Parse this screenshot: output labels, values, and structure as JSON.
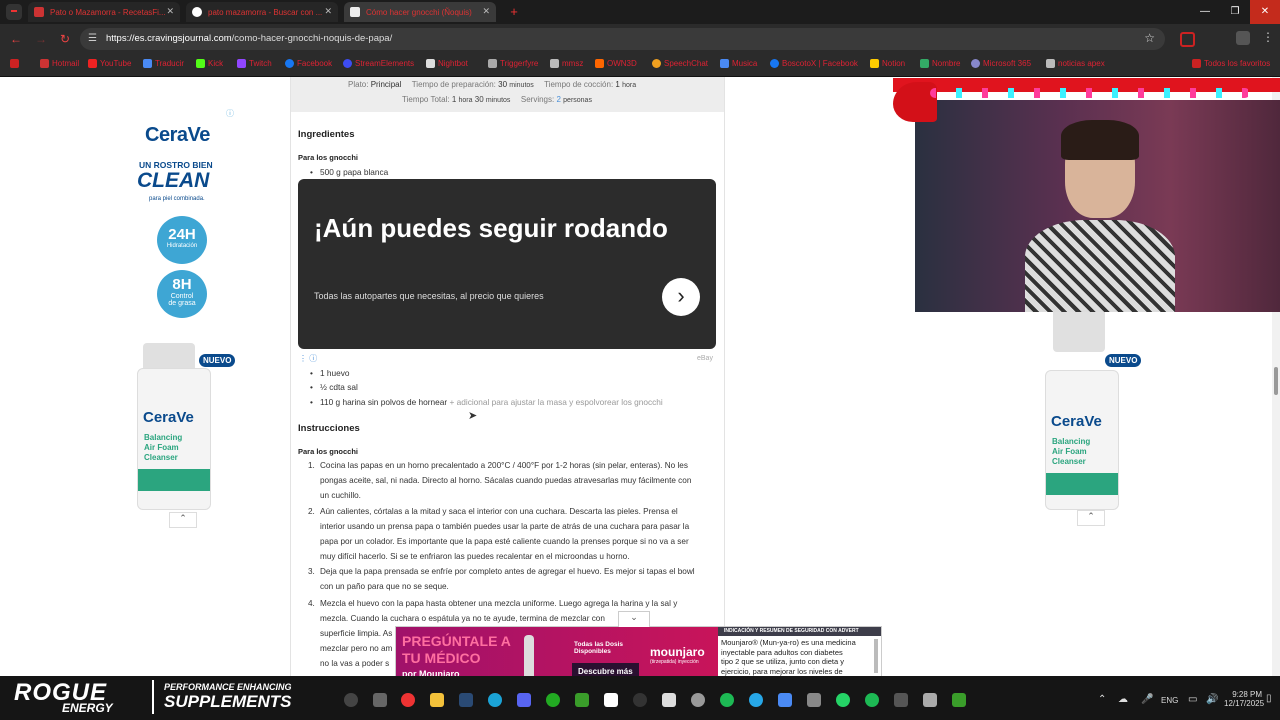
{
  "browser": {
    "tabs": [
      {
        "label": "Pato o Mazamorra - RecetasFi...",
        "active": false
      },
      {
        "label": "pato mazamorra - Buscar con ...",
        "active": false
      },
      {
        "label": "Cómo hacer gnocchi (Ñoquis)",
        "active": true
      }
    ],
    "url_domain": "https://es.cravingsjournal.com",
    "url_path": "/como-hacer-gnocchi-noquis-de-papa/",
    "bookmarks": [
      "Hotmail",
      "YouTube",
      "Traducir",
      "Kick",
      "Twitch",
      "Facebook",
      "StreamElements",
      "Nightbot",
      "Triggerfyre",
      "mmsz",
      "OWN3D",
      "SpeechChat",
      "Musica",
      "BoscotoX | Facebook",
      "Notion",
      "Nombre",
      "Microsoft 365",
      "noticias apex"
    ],
    "all_bookmarks": "Todos los favoritos"
  },
  "recipe": {
    "meta": {
      "plato_label": "Plato:",
      "plato_value": "Principal",
      "prep_label": "Tiempo de preparación:",
      "prep_value": "30",
      "prep_unit": "minutos",
      "cook_label": "Tiempo de cocción:",
      "cook_value": "1",
      "cook_unit": "hora",
      "total_label": "Tiempo Total:",
      "total_h": "1",
      "total_h_unit": "hora",
      "total_m": "30",
      "total_m_unit": "minutos",
      "servings_label": "Servings:",
      "servings_value": "2",
      "servings_unit": "personas"
    },
    "ingredients_title": "Ingredientes",
    "ingredients_group": "Para los gnocchi",
    "ingredients_top": [
      "500 g papa blanca"
    ],
    "ingredients": [
      "1 huevo",
      "½ cdta sal"
    ],
    "ingredient_last": "110 g harina sin polvos de hornear",
    "ingredient_last_note": "+ adicional para ajustar la masa y espolvorear los gnocchi",
    "instructions_title": "Instrucciones",
    "instructions_group": "Para los gnocchi",
    "steps": [
      [
        "Cocina las papas en un horno precalentado a 200°C / 400°F por 1-2 horas (sin pelar, enteras). No les",
        "pongas aceite, sal, ni nada. Directo al horno. Sácalas cuando puedas atravesarlas muy fácilmente con",
        "un cuchillo."
      ],
      [
        "Aún calientes, córtalas a la mitad y saca el interior con una cuchara. Descarta las pieles. Prensa el",
        "interior usando un prensa papa o también puedes usar la parte de atrás de una cuchara para pasar la",
        "papa por un colador. Es importante que la papa esté caliente cuando la prenses porque si no va a ser",
        "muy difícil hacerlo. Si se te enfriaron las puedes recalentar en el microondas u horno."
      ],
      [
        "Deja que la papa prensada se enfríe por completo antes de agregar el huevo. Es mejor si tapas el bowl",
        "con un paño para que no se seque."
      ],
      [
        "Mezcla el huevo con la papa hasta obtener una mezcla uniforme. Luego agrega la harina y la sal y",
        "mezcla. Cuando la cuchara o espátula ya no te ayude, termina de mezclar con",
        "superficie limpia. As",
        "mezclar pero no am",
        "no la vas a poder s"
      ]
    ]
  },
  "ebay_ad": {
    "headline": "¡Aún puedes seguir rodando",
    "body": "Todas las autopartes que necesitas, al precio que quieres",
    "source": "eBay"
  },
  "cerave_left": {
    "brand": "CeraVe",
    "tag1": "UN ROSTRO BIEN",
    "tag2": "CLEAN",
    "tag3": "para piel combinada.",
    "b1_big": "24H",
    "b1_small": "Hidratación",
    "b2_big": "8H",
    "b2_small1": "Control",
    "b2_small2": "de grasa",
    "nuevo": "NUEVO",
    "product_lines": [
      "CeraVe",
      "Balancing",
      "Air Foam",
      "Cleanser"
    ]
  },
  "cerave_right": {
    "nuevo": "NUEVO",
    "product_lines": [
      "CeraVe",
      "Balancing",
      "Air Foam",
      "Cleanser"
    ]
  },
  "mounjaro_ad": {
    "l1": "PREGÚNTALE A",
    "l2": "TU MÉDICO",
    "l3": "por Mounjaro",
    "mid": "Todas las Dosis Disponibles",
    "cta": "Descubre más",
    "brand": "mounjaro",
    "brand_sub": "(tirzepatida) inyección",
    "header": "INDICACIÓN Y RESUMEN DE SEGURIDAD CON ADVERT",
    "body": [
      "Mounjaro® (Mun-ya-ro) es una medicina",
      "inyectable para adultos con diabetes",
      "tipo 2 que se utiliza, junto con dieta y",
      "ejercicio, para mejorar los niveles de"
    ]
  },
  "overlay": {
    "brand1": "ROGUE",
    "brand2": "ENERGY",
    "slogan1": "PERFORMANCE ENHANCING",
    "slogan2": "SUPPLEMENTS"
  },
  "taskbar": {
    "lang": "ENG",
    "time": "9:28 PM",
    "date": "12/17/2025"
  }
}
